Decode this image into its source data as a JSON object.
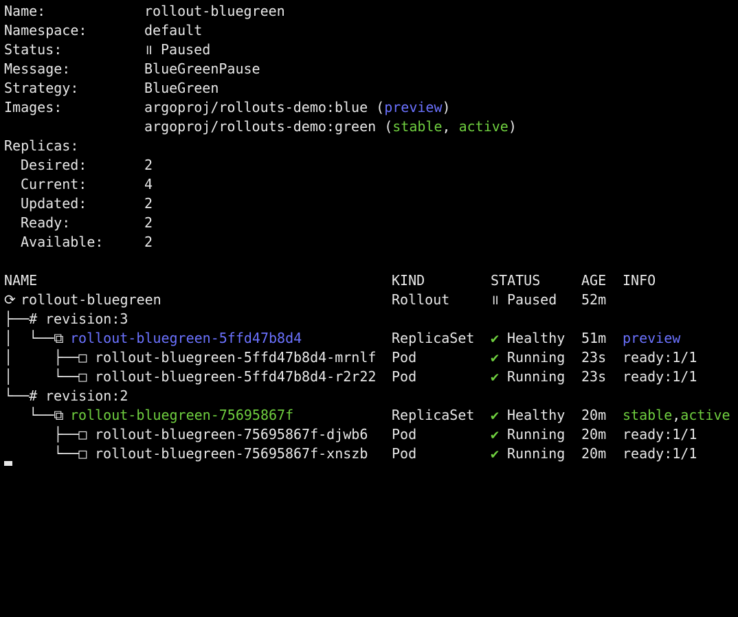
{
  "rollout": {
    "fields": [
      {
        "label": "Name:",
        "value": "rollout-bluegreen"
      },
      {
        "label": "Namespace:",
        "value": "default"
      },
      {
        "label": "Status:",
        "icon": "pause-icon",
        "icon_glyph": "॥",
        "value": "Paused"
      },
      {
        "label": "Message:",
        "value": "BlueGreenPause"
      },
      {
        "label": "Strategy:",
        "value": "BlueGreen"
      }
    ],
    "images_label": "Images:",
    "images": [
      {
        "name": "argoproj/rollouts-demo:blue",
        "open": " (",
        "tag1": "preview",
        "sep": "",
        "tag2": "",
        "close": ")"
      },
      {
        "name": "argoproj/rollouts-demo:green",
        "open": " (",
        "tag1": "stable",
        "sep": ", ",
        "tag2": "active",
        "close": ")"
      }
    ],
    "replicas_label": "Replicas:",
    "replicas": [
      {
        "label": "Desired:",
        "value": "2"
      },
      {
        "label": "Current:",
        "value": "4"
      },
      {
        "label": "Updated:",
        "value": "2"
      },
      {
        "label": "Ready:",
        "value": "2"
      },
      {
        "label": "Available:",
        "value": "2"
      }
    ]
  },
  "table": {
    "headers": {
      "name": "NAME",
      "kind": "KIND",
      "status": "STATUS",
      "age": "AGE",
      "info": "INFO"
    },
    "rows": [
      {
        "prefix": "⟳ ",
        "prefix_icon": "rollout-icon",
        "name": "rollout-bluegreen",
        "kind": "Rollout",
        "status_icon": "॥",
        "status": "Paused",
        "age": "52m",
        "info": ""
      },
      {
        "prefix": "├──# ",
        "name": "revision:3",
        "kind": "",
        "status_icon": "",
        "status": "",
        "age": "",
        "info": ""
      },
      {
        "prefix": "│  └──⧉ ",
        "name": "rollout-bluegreen-5ffd47b8d4",
        "kind": "ReplicaSet",
        "status_icon": "✔",
        "status": "Healthy",
        "age": "51m",
        "info": "preview",
        "info2": ""
      },
      {
        "prefix": "│     ├──□ ",
        "name": "rollout-bluegreen-5ffd47b8d4-mrnlf",
        "kind": "Pod",
        "status_icon": "✔",
        "status": "Running",
        "age": "23s",
        "info": "ready:1/1"
      },
      {
        "prefix": "│     └──□ ",
        "name": "rollout-bluegreen-5ffd47b8d4-r2r22",
        "kind": "Pod",
        "status_icon": "✔",
        "status": "Running",
        "age": "23s",
        "info": "ready:1/1"
      },
      {
        "prefix": "└──# ",
        "name": "revision:2",
        "kind": "",
        "status_icon": "",
        "status": "",
        "age": "",
        "info": ""
      },
      {
        "prefix": "   └──⧉ ",
        "name": "rollout-bluegreen-75695867f",
        "kind": "ReplicaSet",
        "status_icon": "✔",
        "status": "Healthy",
        "age": "20m",
        "info": "stable",
        "info_sep": ",",
        "info2": "active"
      },
      {
        "prefix": "      ├──□ ",
        "name": "rollout-bluegreen-75695867f-djwb6",
        "kind": "Pod",
        "status_icon": "✔",
        "status": "Running",
        "age": "20m",
        "info": "ready:1/1"
      },
      {
        "prefix": "      └──□ ",
        "name": "rollout-bluegreen-75695867f-xnszb",
        "kind": "Pod",
        "status_icon": "✔",
        "status": "Running",
        "age": "20m",
        "info": "ready:1/1"
      }
    ]
  },
  "colors": {
    "background": "#000000",
    "text": "#e8e8e8",
    "preview": "#6b72ff",
    "stable": "#6fcf3f",
    "check": "#6fcf3f"
  }
}
